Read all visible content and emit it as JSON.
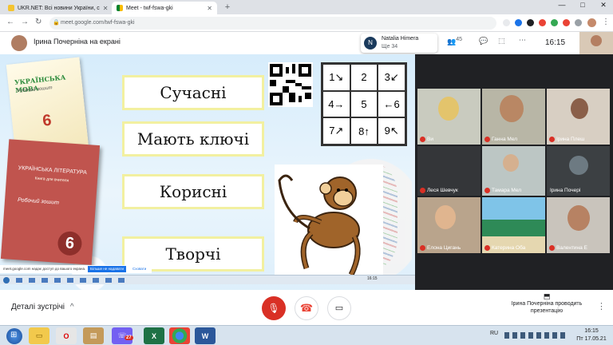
{
  "browser": {
    "tabs": [
      {
        "title": "UKR.NET: Всі новини України, с",
        "active": false
      },
      {
        "title": "Meet - twf-fswa-gki",
        "active": true
      }
    ],
    "new_tab": "+",
    "url": "meet.google.com/twf-fswa-gki",
    "window_controls": {
      "minimize": "—",
      "maximize": "□",
      "close": "✕"
    }
  },
  "meet": {
    "presenter_label": "Ірина Почерніна на екрані",
    "notification": {
      "initial": "N",
      "name": "Natalia Himera",
      "text": "Ще 34"
    },
    "participants_count": "45",
    "clock": "16:15"
  },
  "slide": {
    "book1": {
      "title": "УКРАЇНСЬКА МОВА",
      "subtitle": "Робочий зошит",
      "number": "6"
    },
    "book2": {
      "title": "УКРАЇНСЬКА ЛІТЕРАТУРА",
      "subtitle": "Книга для вчителя",
      "badge": "Робочий зошит",
      "number": "6"
    },
    "words": [
      "Сучасні",
      "Мають ключі",
      "Корисні",
      "Творчі"
    ],
    "grid": [
      [
        "1↘",
        "2",
        "3↙"
      ],
      [
        "4→",
        "5",
        "←6"
      ],
      [
        "7↗",
        "8↑",
        "9↖"
      ]
    ],
    "inner_taskbar_time": "16:15"
  },
  "share_bar": {
    "text": "meet.google.com надає доступ до вашого екрана.",
    "stop": "Більше не надавати",
    "hide": "Сховати"
  },
  "participants": [
    {
      "name": "Ви"
    },
    {
      "name": "Ганна Мел"
    },
    {
      "name": "Ірина Плеш"
    },
    {
      "name": "Леся Шевчук"
    },
    {
      "name": "Тамара Мел"
    },
    {
      "name": "Ірина Почері"
    },
    {
      "name": "Елона Цигань"
    },
    {
      "name": "Катерина Оба"
    },
    {
      "name": "Валентина Е"
    }
  ],
  "controls": {
    "meeting_details": "Деталі зустрічі",
    "presenter_info": "Ірина Почерніна проводить презентацію"
  },
  "taskbar": {
    "apps": [
      "Start",
      "Explorer",
      "Opera",
      "Files",
      "Viber",
      "Excel",
      "Chrome",
      "Word"
    ],
    "viber_badge": "27",
    "lang": "RU",
    "time": "16:15",
    "date": "Пт 17.05.21"
  },
  "colors": {
    "end_call": "#ea4335",
    "mic_off": "#d93025",
    "meet_bg": "#202124"
  }
}
